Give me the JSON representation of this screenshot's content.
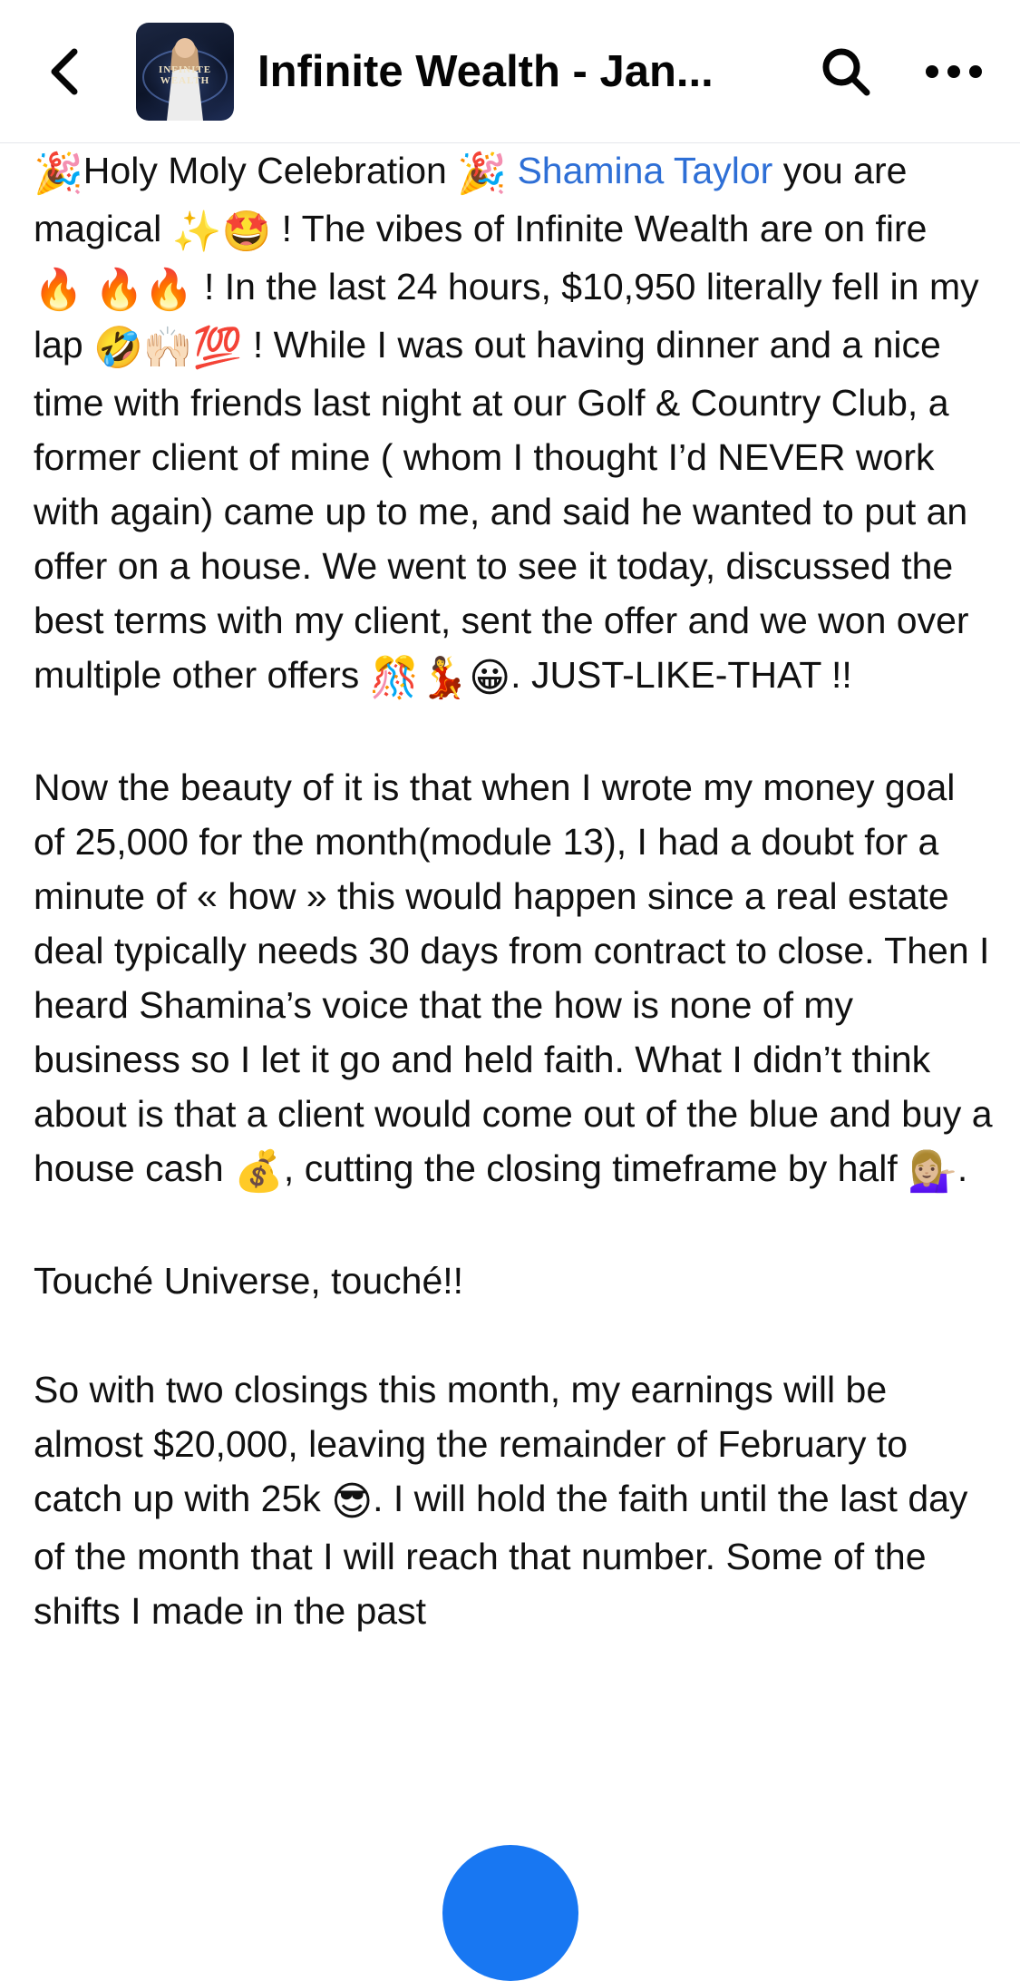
{
  "header": {
    "back_icon": "chevron-left-icon",
    "group_title": "Infinite Wealth - Jan...",
    "avatar_text": "INFINITE WEALTH",
    "search_icon": "search-icon",
    "more_icon": "more-horizontal-icon"
  },
  "colors": {
    "mention": "#2e6fd6",
    "fab": "#1877f2"
  },
  "post": {
    "p1": {
      "e1": "🎉",
      "t1": "Holy Moly Celebration ",
      "e2": "🎉",
      "mention": "Shamina Taylor",
      "t2": " you are magical ",
      "e3": "✨🤩",
      "t3": " ! The vibes of Infinite Wealth are on fire ",
      "e4": "🔥 🔥🔥",
      "t4": " ! In the last 24 hours, $10,950 literally fell in my lap ",
      "e5": "🤣🙌🏻💯",
      "t5": " ! While I was out having dinner and a nice time with friends last night at our Golf & Country Club, a former client of mine ( whom I thought I’d NEVER work with again) came up to me, and said he wanted to put an offer on a house. We went to see it today,  discussed the best terms with my client, sent the offer and we won over multiple other offers ",
      "e6": "🎊💃😀",
      "t6": ". JUST-LIKE-THAT !!"
    },
    "p2": {
      "t1": "Now the beauty of it is that when I wrote my money goal of 25,000 for the month(module 13), I had a doubt for a minute of « how » this would happen since a real estate deal typically needs 30 days from contract to close. Then I heard Shamina’s voice that the how is none of my business so I let it go and held faith. What I didn’t think about is that a client would come out of the blue and buy a house cash ",
      "e1": "💰",
      "t2": ", cutting the closing timeframe by half ",
      "e2": "💁🏼‍♀️",
      "t3": "."
    },
    "p3": {
      "t1": "Touché Universe, touché!!"
    },
    "p4": {
      "t1": "So with two closings this month, my earnings will be almost $20,000, leaving the remainder of February  to catch up with 25k ",
      "e1": "😎",
      "t2": ". I will hold the faith until the last day of the month that I will reach that number. Some of the shifts I made in the past"
    }
  }
}
